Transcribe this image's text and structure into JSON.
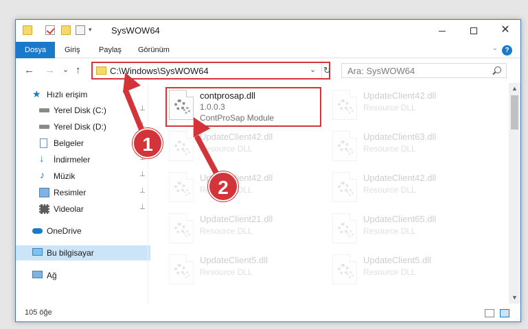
{
  "window": {
    "title": "SysWOW64",
    "minimize_icon": "minimize-icon",
    "maximize_icon": "maximize-icon",
    "close_glyph": "✕"
  },
  "ribbon": {
    "tabs": [
      {
        "label": "Dosya"
      },
      {
        "label": "Giriş"
      },
      {
        "label": "Paylaş"
      },
      {
        "label": "Görünüm"
      }
    ],
    "help": "?",
    "collapse": "⌄"
  },
  "nav": {
    "back": "←",
    "forward": "→",
    "recent": "⌄",
    "up": "↑",
    "address": "C:\\Windows\\SysWOW64",
    "address_dropdown": "⌄",
    "refresh": "↻",
    "search_placeholder": "Ara: SysWOW64"
  },
  "sidebar": {
    "items": [
      {
        "label": "Hızlı erişim",
        "icon": "star-icon"
      },
      {
        "label": "Yerel Disk (C:)",
        "icon": "drive-icon"
      },
      {
        "label": "Yerel Disk (D:)",
        "icon": "drive-icon"
      },
      {
        "label": "Belgeler",
        "icon": "documents-icon"
      },
      {
        "label": "İndirmeler",
        "icon": "download-icon"
      },
      {
        "label": "Müzik",
        "icon": "music-icon"
      },
      {
        "label": "Resimler",
        "icon": "pictures-icon"
      },
      {
        "label": "Videolar",
        "icon": "videos-icon"
      },
      {
        "label": "OneDrive",
        "icon": "cloud-icon"
      },
      {
        "label": "Bu bilgisayar",
        "icon": "computer-icon"
      },
      {
        "label": "Ağ",
        "icon": "network-icon"
      }
    ],
    "pin_glyph": "📌"
  },
  "files": [
    {
      "name": "contprosap.dll",
      "version": "1.0.0.3",
      "desc": "ContProSap Module"
    },
    {
      "name": "UpdateClient42.dll",
      "version": "",
      "desc": "Resource DLL"
    },
    {
      "name": "UpdateClient42.dll",
      "version": "",
      "desc": "Resource DLL"
    },
    {
      "name": "UpdateClient63.dll",
      "version": "",
      "desc": "Resource DLL"
    },
    {
      "name": "UpdateClient42.dll",
      "version": "",
      "desc": "Resource DLL"
    },
    {
      "name": "UpdateClient42.dll",
      "version": "",
      "desc": "Resource DLL"
    },
    {
      "name": "UpdateClient21.dll",
      "version": "",
      "desc": "Resource DLL"
    },
    {
      "name": "UpdateClient65.dll",
      "version": "",
      "desc": "Resource DLL"
    },
    {
      "name": "UpdateClient5.dll",
      "version": "",
      "desc": "Resource DLL"
    },
    {
      "name": "UpdateClient5.dll",
      "version": "",
      "desc": "Resource DLL"
    }
  ],
  "status": {
    "count": "105 öğe"
  },
  "annotations": {
    "badge1": "1",
    "badge2": "2",
    "color": "#d2343a"
  },
  "colors": {
    "accent": "#1979ca",
    "selection": "#cce4f7"
  }
}
